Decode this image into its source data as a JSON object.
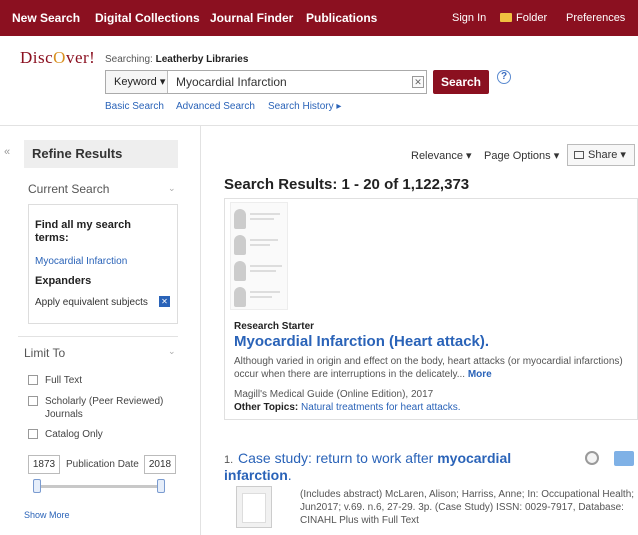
{
  "topnav": {
    "items": [
      "New Search",
      "Digital Collections",
      "Journal Finder",
      "Publications"
    ],
    "sign_in": "Sign In",
    "folder": "Folder",
    "preferences": "Preferences",
    "bg_color": "#8b1020"
  },
  "logo": {
    "pre": "Disc",
    "mid": "O",
    "post": "ver!"
  },
  "search": {
    "searching_label": "Searching:",
    "library": "Leatherby Libraries",
    "field": "Keyword",
    "query": "Myocardial Infarction",
    "button": "Search",
    "links": [
      "Basic Search",
      "Advanced Search",
      "History"
    ],
    "history_prefix": "Search"
  },
  "sidebar": {
    "header": "Refine Results",
    "current_search": {
      "title": "Current Search",
      "find_all": "Find all my search terms:",
      "term": "Myocardial Infarction",
      "expanders": "Expanders",
      "apply": "Apply equivalent subjects"
    },
    "limit_to": {
      "title": "Limit To",
      "full_text": "Full Text",
      "scholarly": "Scholarly (Peer Reviewed) Journals",
      "catalog": "Catalog Only",
      "date_from": "1873",
      "date_label": "Publication Date",
      "date_to": "2018"
    },
    "show_more": "Show More"
  },
  "toolbar": {
    "relevance": "Relevance",
    "page_options": "Page Options",
    "share": "Share"
  },
  "results": {
    "heading": "Search Results: 1 - 20 of 1,122,373",
    "research_starter": {
      "label": "Research Starter",
      "title": "Myocardial Infarction (Heart attack).",
      "desc": "Although varied in origin and effect on the body, heart attacks (or myocardial infarctions) occur when there are interruptions in the delicately...",
      "more": "More",
      "source": "Magill's Medical Guide (Online Edition), 2017",
      "other_topics_label": "Other Topics:",
      "other_topics": "Natural treatments for heart attacks."
    },
    "items": [
      {
        "number": "1.",
        "title_pre": "Case study: return to work after",
        "title_bold": "myocardial infarction",
        "title_post": ".",
        "meta": "(Includes abstract) McLaren, Alison; Harriss, Anne; In: Occupational Health; Jun2017; v.69. n.6, 27-29. 3p. (Case Study) ISSN: 0029-7917, Database: CINAHL Plus with Full Text"
      }
    ]
  }
}
